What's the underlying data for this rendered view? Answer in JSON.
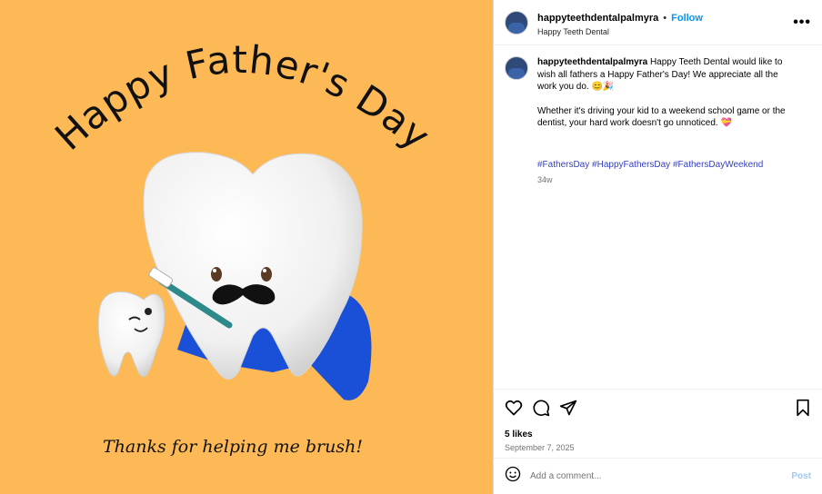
{
  "media": {
    "headline": "Happy Father's Day",
    "tagline": "Thanks for helping me brush!",
    "colors": {
      "background": "#FDB955",
      "cape": "#1a4fd8"
    }
  },
  "header": {
    "username": "happyteethdentalpalmyra",
    "separator": "•",
    "follow_label": "Follow",
    "subtitle": "Happy Teeth Dental",
    "more_label": "•••"
  },
  "caption": {
    "username": "happyteethdentalpalmyra",
    "text1": "Happy Teeth Dental would like to wish all fathers a Happy Father's Day! We appreciate all the work you do. 😊🎉",
    "text2": "Whether it's driving your kid to a weekend school game or the dentist, your hard work doesn't go unnoticed. 💝",
    "hashtags": [
      "#FathersDay",
      "#HappyFathersDay",
      "#FathersDayWeekend"
    ],
    "age": "34w"
  },
  "actions": {
    "icons": [
      "heart-icon",
      "comment-icon",
      "share-icon",
      "bookmark-icon"
    ],
    "likes": "5 likes",
    "date": "September 7, 2025"
  },
  "comment": {
    "placeholder": "Add a comment...",
    "post_label": "Post"
  }
}
